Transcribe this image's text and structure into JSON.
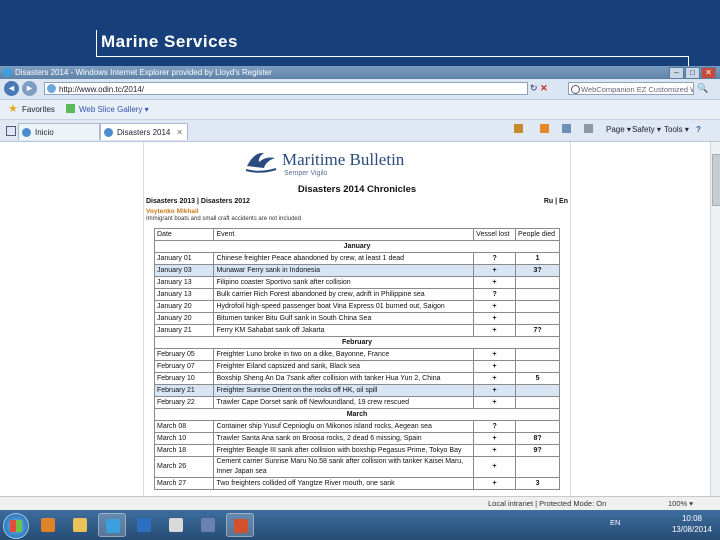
{
  "slide": {
    "title": "Marine Services"
  },
  "window": {
    "title": "Disasters 2014 - Windows Internet Explorer provided by Lloyd's Register",
    "controls": {
      "minimize": "–",
      "maximize": "□",
      "close": "✕"
    }
  },
  "address_bar": {
    "back": "◄",
    "forward": "►",
    "url": "http://www.odin.tc/2014/",
    "refresh": "↻",
    "stop": "✕",
    "search_placeholder": "WebCompanion EZ Customized Web Search",
    "search_go": "🔍"
  },
  "favorites_bar": {
    "favorites": "Favorites",
    "web_slice": "Web Slice Gallery ▾"
  },
  "tabs": [
    {
      "label": "Inicio"
    },
    {
      "label": "Disasters 2014",
      "close": "✕"
    }
  ],
  "command_bar": {
    "page": "Page ▾",
    "safety": "Safety ▾",
    "tools": "Tools ▾",
    "help": "?"
  },
  "page": {
    "brand": "Maritime Bulletin",
    "motto": "Semper Vigilo",
    "heading": "Disasters 2014 Chronicles",
    "nav_left": "Disasters 2013  |  Disasters 2012",
    "nav_right": "Ru | En",
    "editor": "Voytenko Mikhail",
    "note": "Immigrant boats and small craft accidents are not included",
    "table_headers": {
      "date": "Date",
      "event": "Event",
      "vessel_lost": "Vessel lost",
      "people_died": "People died"
    },
    "sections": [
      {
        "month": "January",
        "rows": [
          {
            "date": "January 01",
            "event": "Chinese freighter Peace abandoned by crew, at least 1 dead",
            "lost": "?",
            "died": "1",
            "hl": false
          },
          {
            "date": "January 03",
            "event": "Munawar Ferry sank in Indonesia",
            "lost": "+",
            "died": "3?",
            "hl": true
          },
          {
            "date": "January 13",
            "event": "Filipino coaster Sportivo sank after collision",
            "lost": "+",
            "died": "",
            "hl": false
          },
          {
            "date": "January 13",
            "event": "Bulk carrier Rich Forest abandoned by crew, adrift in Philippine sea",
            "lost": "?",
            "died": "",
            "hl": false
          },
          {
            "date": "January 20",
            "event": "Hydrofoil high-speed passenger boat Vina Express 01 burned out, Saigon",
            "lost": "+",
            "died": "",
            "hl": false
          },
          {
            "date": "January 20",
            "event": "Bitumen tanker Bitu Gulf sank in South China Sea",
            "lost": "+",
            "died": "",
            "hl": false
          },
          {
            "date": "January 21",
            "event": "Ferry KM Sahabat sank off Jakarta",
            "lost": "+",
            "died": "7?",
            "hl": false
          }
        ]
      },
      {
        "month": "February",
        "rows": [
          {
            "date": "February 05",
            "event": "Freighter Luno broke in two on a dike, Bayonne, France",
            "lost": "+",
            "died": "",
            "hl": false
          },
          {
            "date": "February 07",
            "event": "Freighter Eiland capsized and sank, Black sea",
            "lost": "+",
            "died": "",
            "hl": false
          },
          {
            "date": "February 10",
            "event": "Boxship Sheng An Da 7sank after collision with tanker Hua Yun 2, China",
            "lost": "+",
            "died": "5",
            "hl": false
          },
          {
            "date": "February 21",
            "event": "Freighter Sunrise Orient on the rocks off HK, oil spill",
            "lost": "+",
            "died": "",
            "hl": true
          },
          {
            "date": "February 22",
            "event": "Trawler Cape Dorset sank off Newfoundland, 19 crew rescued",
            "lost": "+",
            "died": "",
            "hl": false
          }
        ]
      },
      {
        "month": "March",
        "rows": [
          {
            "date": "March 08",
            "event": "Container ship Yusuf Cepnioglu on Mikonos island rocks, Aegean sea",
            "lost": "?",
            "died": "",
            "hl": false
          },
          {
            "date": "March 10",
            "event": "Trawler Santa Ana sank on Broosa rocks, 2 dead 6 missing, Spain",
            "lost": "+",
            "died": "8?",
            "hl": false
          },
          {
            "date": "March 18",
            "event": "Freighter Beagle III sank after collision with boxship Pegasus Prime, Tokyo Bay",
            "lost": "+",
            "died": "9?",
            "hl": false
          },
          {
            "date": "March 26",
            "event": "Cement carrier Sunrise Maru No.58 sank after collision with tanker Kaisei Maru, Inner Japan sea",
            "lost": "+",
            "died": "",
            "hl": false,
            "tall": true
          },
          {
            "date": "March 27",
            "event": "Two freighters collided off Yangtze River mouth, one sank",
            "lost": "+",
            "died": "3",
            "hl": false
          }
        ]
      }
    ]
  },
  "status_bar": {
    "zone": "Local intranet | Protected Mode: On",
    "zoom": "100% ▾"
  },
  "taskbar": {
    "items": [
      {
        "name": "media-player-icon",
        "color": "#e0842b",
        "on": false
      },
      {
        "name": "explorer-folder-icon",
        "color": "#e9c25a",
        "on": false
      },
      {
        "name": "internet-explorer-icon",
        "color": "#3aa0e0",
        "on": true
      },
      {
        "name": "outlook-icon",
        "color": "#2f6fc0",
        "on": false
      },
      {
        "name": "chart-app-icon",
        "color": "#d9d9d9",
        "on": false
      },
      {
        "name": "calendar-app-icon",
        "color": "#6b7fb0",
        "on": false
      },
      {
        "name": "powerpoint-icon",
        "color": "#d2502c",
        "on": true
      }
    ],
    "lang": "EN",
    "time": "10:08",
    "date": "13/08/2014"
  }
}
